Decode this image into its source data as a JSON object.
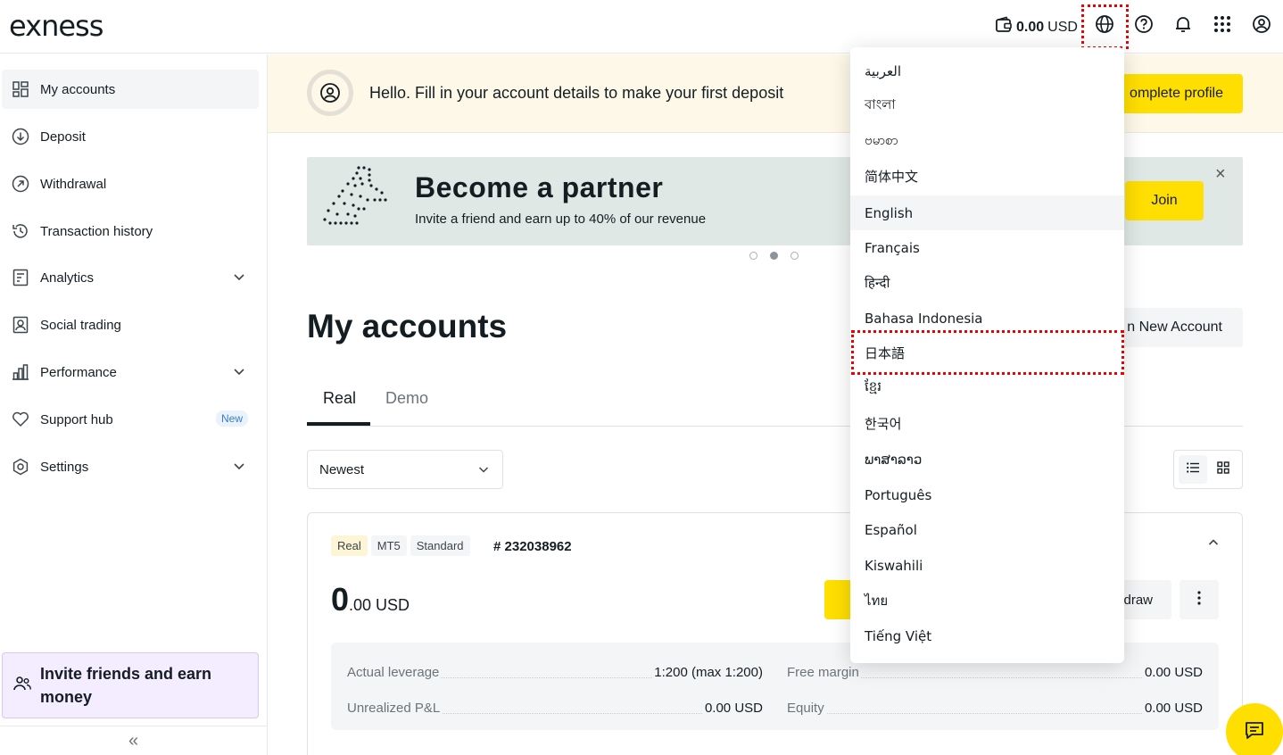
{
  "header": {
    "logo": "exness",
    "balance_amount": "0.00",
    "balance_currency": "USD"
  },
  "sidebar": {
    "items": [
      {
        "label": "My accounts",
        "icon": "grid-icon"
      },
      {
        "label": "Deposit",
        "icon": "arrow-down-circle-icon"
      },
      {
        "label": "Withdrawal",
        "icon": "arrow-up-right-circle-icon"
      },
      {
        "label": "Transaction history",
        "icon": "history-icon"
      },
      {
        "label": "Analytics",
        "icon": "analytics-icon"
      },
      {
        "label": "Social trading",
        "icon": "social-trading-icon"
      },
      {
        "label": "Performance",
        "icon": "bar-chart-icon"
      },
      {
        "label": "Support hub",
        "icon": "heart-icon",
        "badge": "New"
      },
      {
        "label": "Settings",
        "icon": "gear-icon"
      }
    ],
    "invite_line1": "Invite friends and earn",
    "invite_line2": "money",
    "collapse_glyph": "«"
  },
  "notice": {
    "text": "Hello. Fill in your account details to make your first deposit",
    "button": "omplete profile"
  },
  "promo": {
    "title": "Become a partner",
    "subtitle": "Invite a friend and earn up to 40% of our revenue",
    "join": "Join",
    "close": "×"
  },
  "page": {
    "title": "My accounts",
    "open_account": "n New Account"
  },
  "tabs": {
    "real": "Real",
    "demo": "Demo"
  },
  "sort": {
    "value": "Newest"
  },
  "account": {
    "pills": [
      "Real",
      "MT5",
      "Standard"
    ],
    "number": "# 232038962",
    "balance_int": "0",
    "balance_dec": ".00 USD",
    "withdraw": "draw",
    "stats": {
      "actual_leverage_label": "Actual leverage",
      "actual_leverage_value": "1:200 (max 1:200)",
      "free_margin_label": "Free margin",
      "free_margin_value": "0.00 USD",
      "unrealized_label": "Unrealized P&L",
      "unrealized_value": "0.00 USD",
      "equity_label": "Equity",
      "equity_value": "0.00 USD"
    }
  },
  "languages": [
    "العربية",
    "বাংলা",
    "ဗမာစာ",
    "简体中文",
    "English",
    "Français",
    "हिन्दी",
    "Bahasa Indonesia",
    "日本語",
    "ខ្មែរ",
    "한국어",
    "ພາສາລາວ",
    "Português",
    "Español",
    "Kiswahili",
    "ไทย",
    "Tiếng Việt"
  ],
  "colors": {
    "accent_yellow": "#ffde02",
    "highlight_red": "#e00000",
    "invite_bg": "#f4ecff"
  }
}
